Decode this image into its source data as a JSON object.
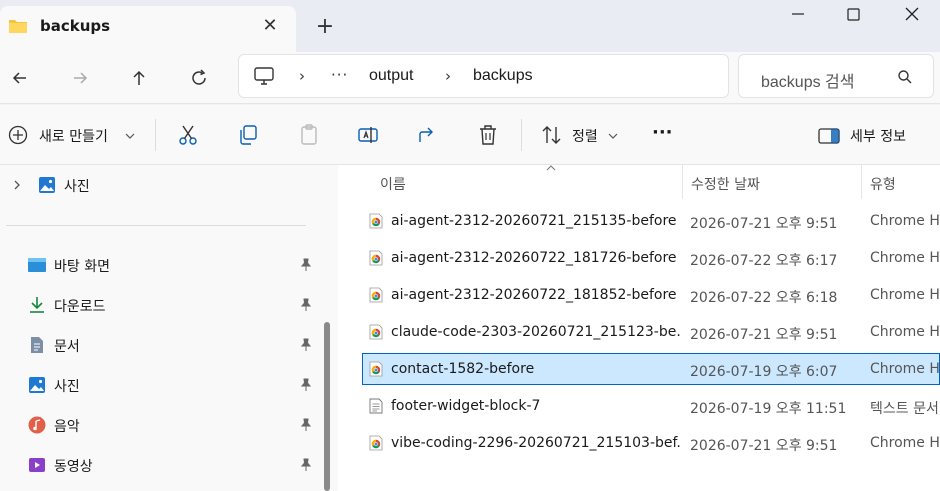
{
  "window": {
    "tab_title": "backups",
    "close_tab_glyph": "✕",
    "new_tab_glyph": "+"
  },
  "address": {
    "ellipsis": "···",
    "segments": [
      "output",
      "backups"
    ],
    "search_placeholder": "backups 검색"
  },
  "toolbar": {
    "new_label": "새로 만들기",
    "sort_label": "정렬",
    "more_label": "···",
    "details_label": "세부 정보"
  },
  "sidebar": {
    "top_item": "사진",
    "items": [
      {
        "label": "바탕 화면",
        "icon": "desktop-icon"
      },
      {
        "label": "다운로드",
        "icon": "download-icon"
      },
      {
        "label": "문서",
        "icon": "document-icon"
      },
      {
        "label": "사진",
        "icon": "pictures-icon"
      },
      {
        "label": "음악",
        "icon": "music-icon"
      },
      {
        "label": "동영상",
        "icon": "video-icon"
      }
    ]
  },
  "columns": {
    "name": "이름",
    "modified": "수정한 날짜",
    "type": "유형"
  },
  "files": [
    {
      "name": "ai-agent-2312-20260721_215135-before",
      "date": "2026-07-21 오후 9:51",
      "type": "Chrome HTML",
      "icon": "chrome-html-icon"
    },
    {
      "name": "ai-agent-2312-20260722_181726-before",
      "date": "2026-07-22 오후 6:17",
      "type": "Chrome HTML",
      "icon": "chrome-html-icon"
    },
    {
      "name": "ai-agent-2312-20260722_181852-before",
      "date": "2026-07-22 오후 6:18",
      "type": "Chrome HTML",
      "icon": "chrome-html-icon"
    },
    {
      "name": "claude-code-2303-20260721_215123-be...",
      "date": "2026-07-21 오후 9:51",
      "type": "Chrome HTML",
      "icon": "chrome-html-icon"
    },
    {
      "name": "contact-1582-before",
      "date": "2026-07-19 오후 6:07",
      "type": "Chrome HTML",
      "icon": "chrome-html-icon",
      "selected": true
    },
    {
      "name": "footer-widget-block-7",
      "date": "2026-07-19 오후 11:51",
      "type": "텍스트 문서",
      "icon": "text-file-icon"
    },
    {
      "name": "vibe-coding-2296-20260721_215103-bef...",
      "date": "2026-07-21 오후 9:51",
      "type": "Chrome HTML",
      "icon": "chrome-html-icon"
    }
  ],
  "colors": {
    "accent": "#0067c0",
    "selection": "#cce8ff"
  }
}
